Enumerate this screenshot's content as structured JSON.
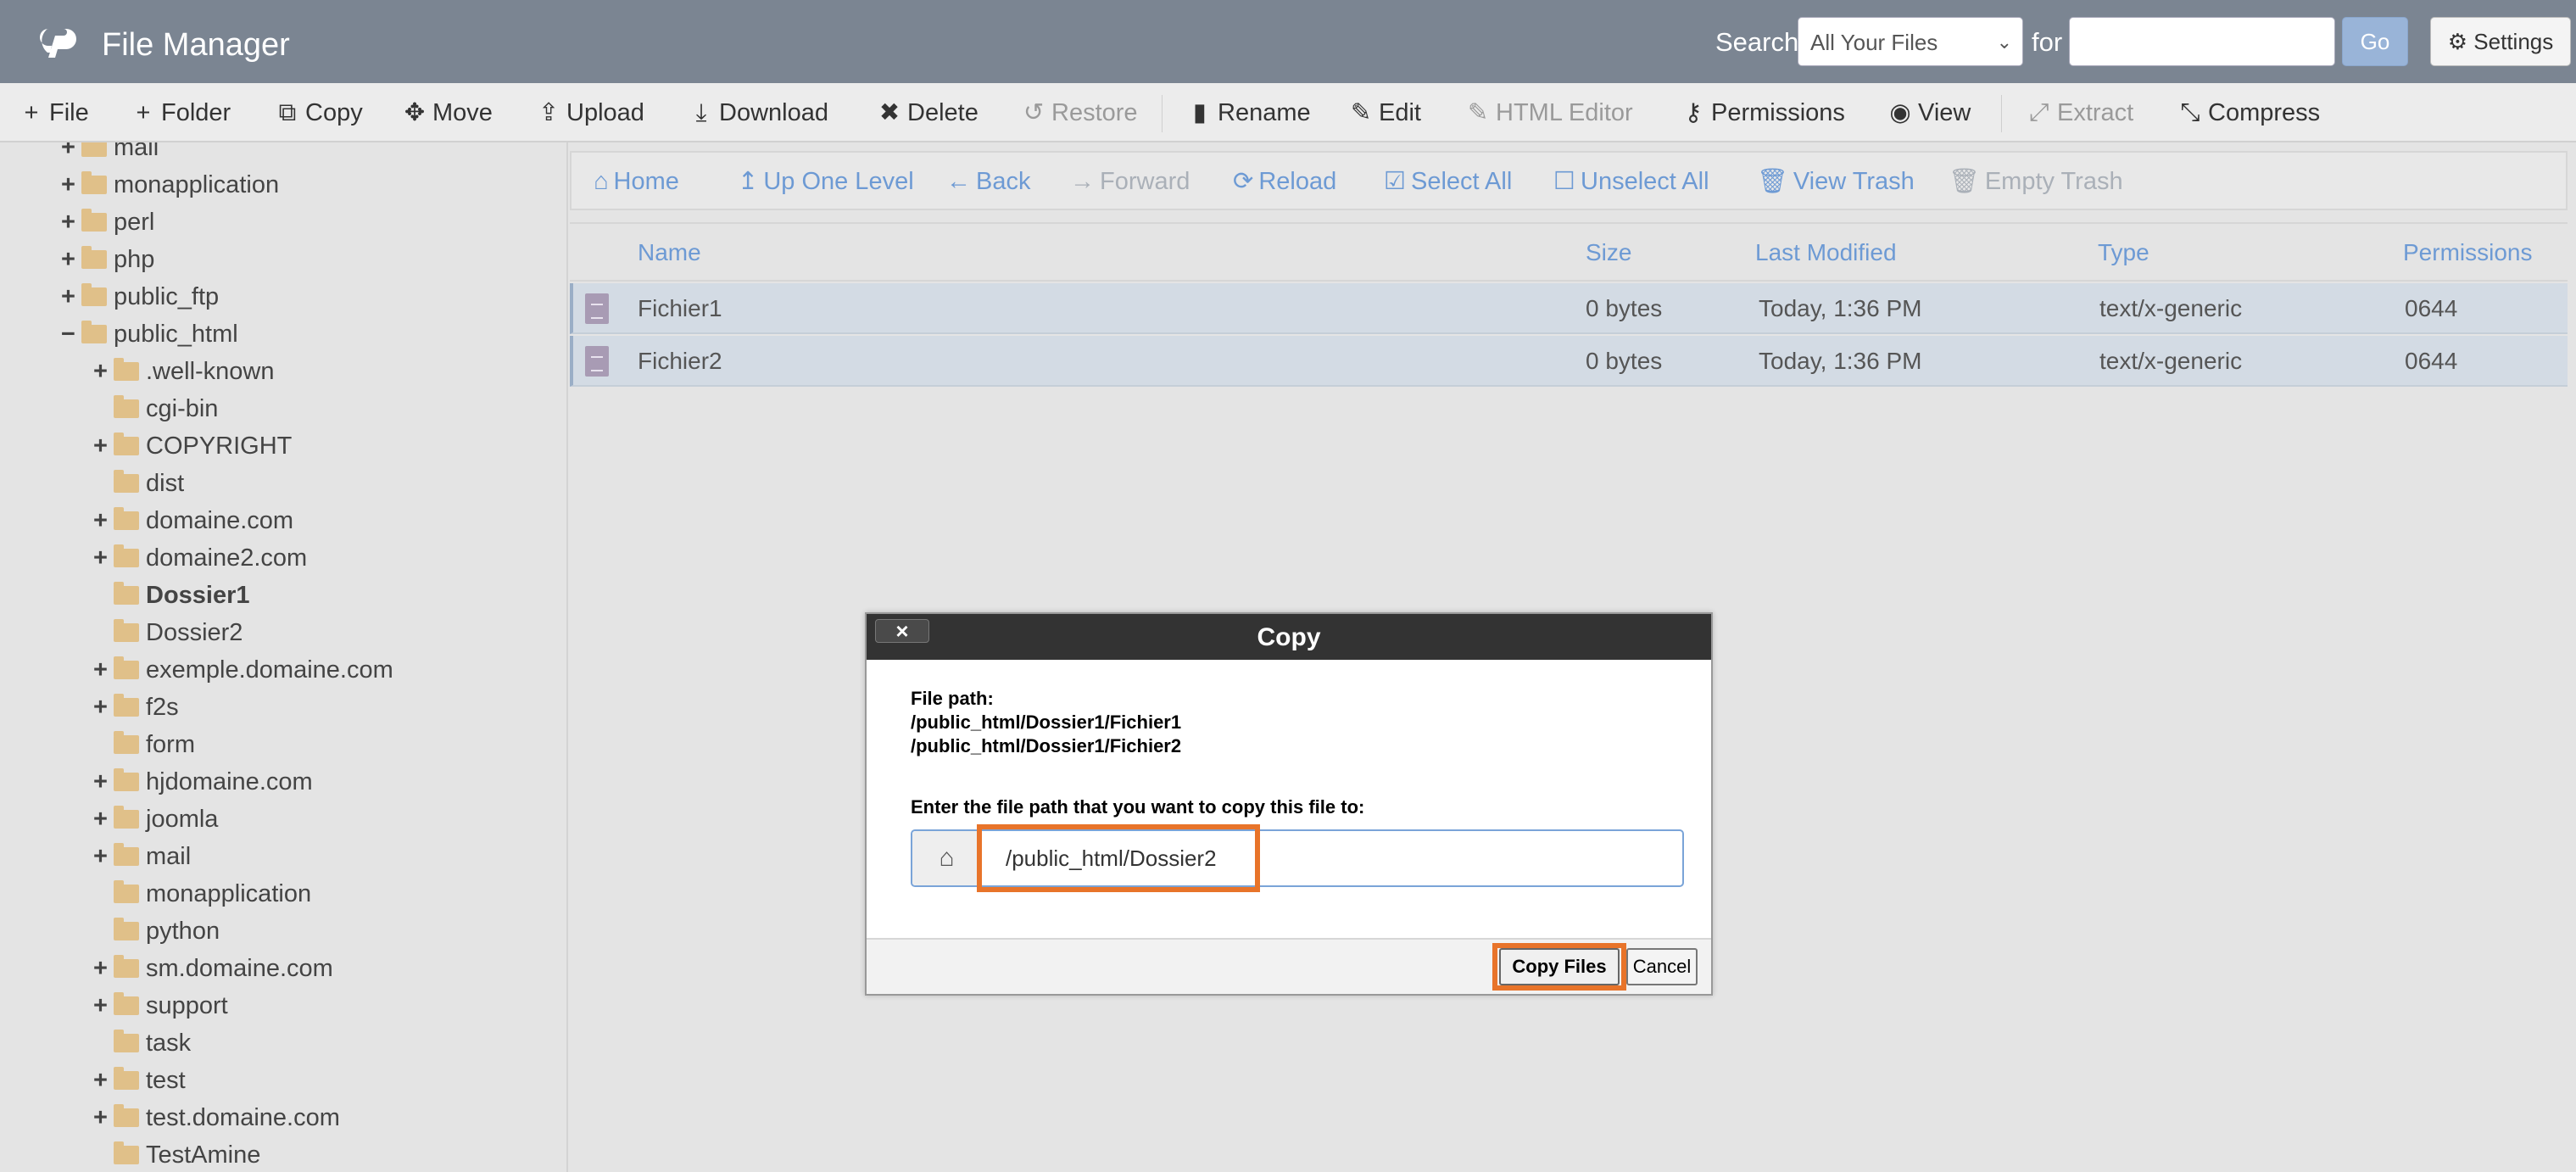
{
  "header": {
    "app_title": "File Manager",
    "search_label": "Search",
    "search_scope": "All Your Files",
    "for_label": "for",
    "search_value": "",
    "go_label": "Go",
    "settings_label": "Settings"
  },
  "toolbar": {
    "file": "File",
    "folder": "Folder",
    "copy": "Copy",
    "move": "Move",
    "upload": "Upload",
    "download": "Download",
    "delete": "Delete",
    "restore": "Restore",
    "rename": "Rename",
    "edit": "Edit",
    "html_editor": "HTML Editor",
    "permissions": "Permissions",
    "view": "View",
    "extract": "Extract",
    "compress": "Compress"
  },
  "tree": {
    "items": [
      {
        "label": "mail",
        "pm": "+"
      },
      {
        "label": "monapplication",
        "pm": "+"
      },
      {
        "label": "perl",
        "pm": "+"
      },
      {
        "label": "php",
        "pm": "+"
      },
      {
        "label": "public_ftp",
        "pm": "+"
      },
      {
        "label": "public_html",
        "pm": "−"
      },
      {
        "label": ".well-known",
        "pm": "+"
      },
      {
        "label": "cgi-bin",
        "pm": ""
      },
      {
        "label": "COPYRIGHT",
        "pm": "+"
      },
      {
        "label": "dist",
        "pm": ""
      },
      {
        "label": "domaine.com",
        "pm": "+"
      },
      {
        "label": "domaine2.com",
        "pm": "+"
      },
      {
        "label": "Dossier1",
        "pm": ""
      },
      {
        "label": "Dossier2",
        "pm": ""
      },
      {
        "label": "exemple.domaine.com",
        "pm": "+"
      },
      {
        "label": "f2s",
        "pm": "+"
      },
      {
        "label": "form",
        "pm": ""
      },
      {
        "label": "hjdomaine.com",
        "pm": "+"
      },
      {
        "label": "joomla",
        "pm": "+"
      },
      {
        "label": "mail",
        "pm": "+"
      },
      {
        "label": "monapplication",
        "pm": ""
      },
      {
        "label": "python",
        "pm": ""
      },
      {
        "label": "sm.domaine.com",
        "pm": "+"
      },
      {
        "label": "support",
        "pm": "+"
      },
      {
        "label": "task",
        "pm": ""
      },
      {
        "label": "test",
        "pm": "+"
      },
      {
        "label": "test.domaine.com",
        "pm": "+"
      },
      {
        "label": "TestAmine",
        "pm": ""
      }
    ]
  },
  "nav": {
    "home": "Home",
    "up": "Up One Level",
    "back": "Back",
    "forward": "Forward",
    "reload": "Reload",
    "select_all": "Select All",
    "unselect_all": "Unselect All",
    "view_trash": "View Trash",
    "empty_trash": "Empty Trash"
  },
  "table": {
    "columns": [
      "Name",
      "Size",
      "Last Modified",
      "Type",
      "Permissions"
    ],
    "rows": [
      {
        "name": "Fichier1",
        "size": "0 bytes",
        "modified": "Today, 1:36 PM",
        "type": "text/x-generic",
        "perms": "0644"
      },
      {
        "name": "Fichier2",
        "size": "0 bytes",
        "modified": "Today, 1:36 PM",
        "type": "text/x-generic",
        "perms": "0644"
      }
    ]
  },
  "dialog": {
    "title": "Copy",
    "close": "×",
    "file_path_label": "File path:",
    "paths": [
      "/public_html/Dossier1/Fichier1",
      "/public_html/Dossier1/Fichier2"
    ],
    "prompt": "Enter the file path that you want to copy this file to:",
    "target_path": "/public_html/Dossier2",
    "copy_button": "Copy Files",
    "cancel_button": "Cancel"
  }
}
